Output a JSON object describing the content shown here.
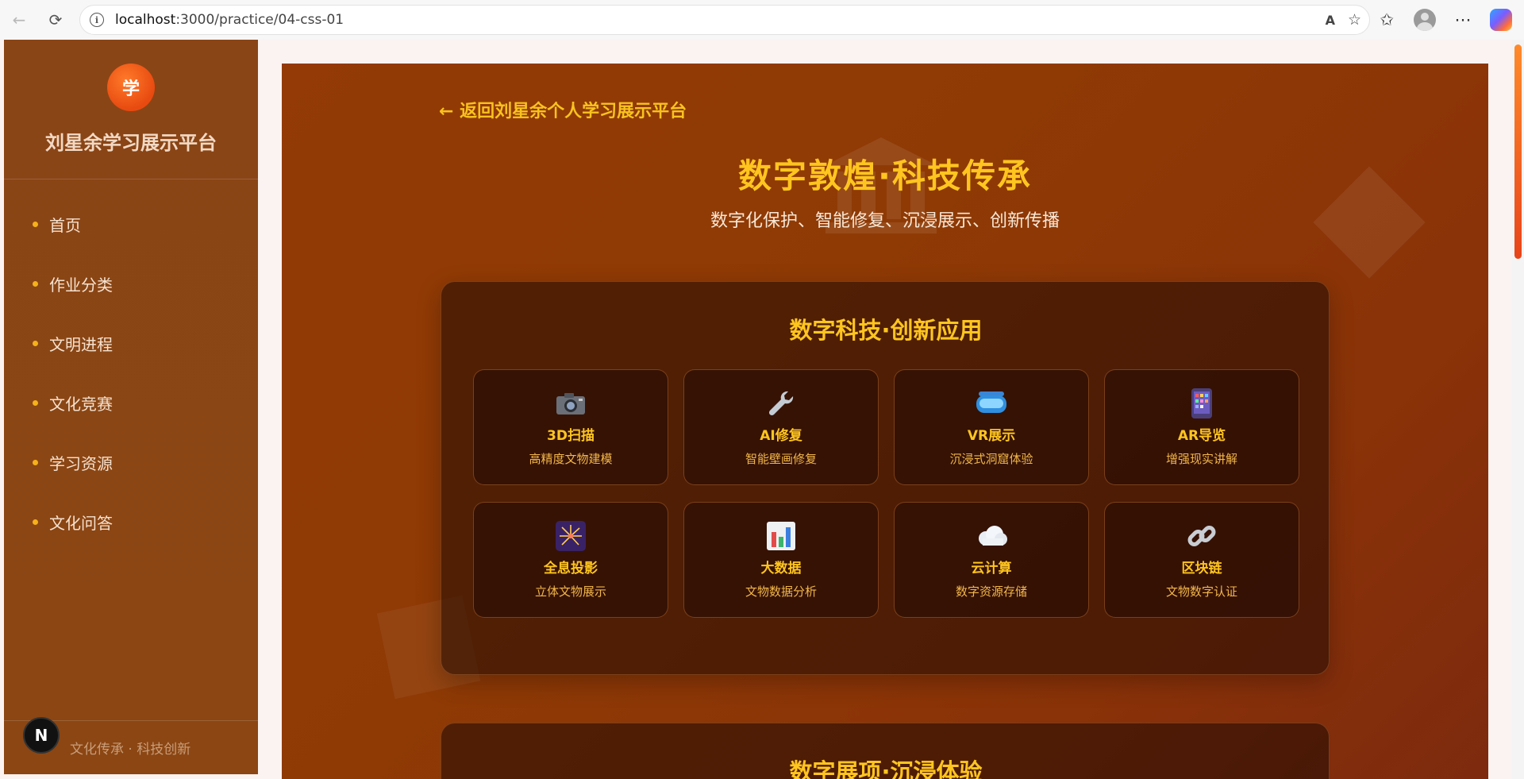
{
  "browser": {
    "url_host": "localhost",
    "url_path": ":3000/practice/04-css-01"
  },
  "sidebar": {
    "logo_char": "学",
    "site_name": "刘星余学习展示平台",
    "items": [
      {
        "label": "首页"
      },
      {
        "label": "作业分类"
      },
      {
        "label": "文明进程"
      },
      {
        "label": "文化竞赛"
      },
      {
        "label": "学习资源"
      },
      {
        "label": "文化问答"
      }
    ],
    "badge": "N",
    "footer": "文化传承 · 科技创新"
  },
  "main": {
    "back_link": "← 返回刘星余个人学习展示平台",
    "title": "数字敦煌·科技传承",
    "subtitle": "数字化保护、智能修复、沉浸展示、创新传播",
    "section1": {
      "title": "数字科技·创新应用",
      "cards": [
        {
          "icon": "camera-icon",
          "title": "3D扫描",
          "desc": "高精度文物建模"
        },
        {
          "icon": "wrench-icon",
          "title": "AI修复",
          "desc": "智能壁画修复"
        },
        {
          "icon": "vr-goggles-icon",
          "title": "VR展示",
          "desc": "沉浸式洞窟体验"
        },
        {
          "icon": "mobile-phone-icon",
          "title": "AR导览",
          "desc": "增强现实讲解"
        },
        {
          "icon": "sparkler-icon",
          "title": "全息投影",
          "desc": "立体文物展示"
        },
        {
          "icon": "bar-chart-icon",
          "title": "大数据",
          "desc": "文物数据分析"
        },
        {
          "icon": "cloud-icon",
          "title": "云计算",
          "desc": "数字资源存储"
        },
        {
          "icon": "link-icon",
          "title": "区块链",
          "desc": "文物数字认证"
        }
      ]
    },
    "section2": {
      "title": "数字展项·沉浸体验"
    }
  },
  "colors": {
    "accent_gold": "#ffc51f",
    "sidebar_bg": "#8a4516",
    "main_bg": "#933a06"
  }
}
